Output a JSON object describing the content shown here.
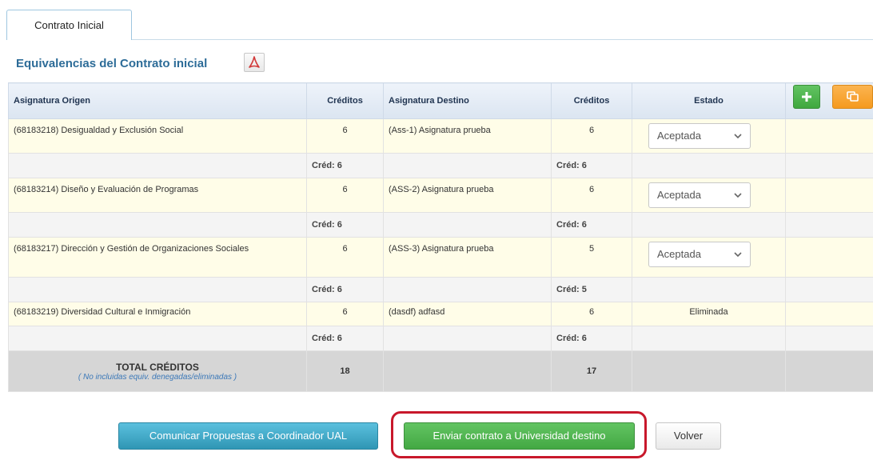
{
  "tabs": [
    {
      "label": "Contrato Inicial",
      "active": true
    }
  ],
  "section": {
    "title": "Equivalencias del Contrato inicial",
    "pdf_icon": "pdf-icon"
  },
  "table": {
    "headers": {
      "origin": "Asignatura Origen",
      "credits_origin": "Créditos",
      "destination": "Asignatura Destino",
      "credits_destination": "Créditos",
      "state": "Estado"
    },
    "rows": [
      {
        "origin": "(68183218) Desigualdad y Exclusión Social",
        "credits_origin": "6",
        "destination": "(Ass-1) Asignatura prueba",
        "credits_destination": "6",
        "state": "Aceptada",
        "state_editable": true,
        "sub_origin": "Créd: 6",
        "sub_destination": "Créd: 6"
      },
      {
        "origin": "(68183214) Diseño y Evaluación de Programas",
        "credits_origin": "6",
        "destination": "(ASS-2) Asignatura prueba",
        "credits_destination": "6",
        "state": "Aceptada",
        "state_editable": true,
        "sub_origin": "Créd: 6",
        "sub_destination": "Créd: 6"
      },
      {
        "origin": "(68183217) Dirección y Gestión de Organizaciones Sociales",
        "credits_origin": "6",
        "destination": "(ASS-3) Asignatura prueba",
        "credits_destination": "5",
        "state": "Aceptada",
        "state_editable": true,
        "sub_origin": "Créd: 6",
        "sub_destination": "Créd: 5"
      },
      {
        "origin": "(68183219) Diversidad Cultural e Inmigración",
        "credits_origin": "6",
        "destination": "(dasdf) adfasd",
        "credits_destination": "6",
        "state": "Eliminada",
        "state_editable": false,
        "sub_origin": "Créd: 6",
        "sub_destination": "Créd: 6"
      }
    ],
    "total": {
      "label": "TOTAL CRÉDITOS",
      "note": "( No incluidas equiv. denegadas/eliminadas )",
      "credits_origin": "18",
      "credits_destination": "17"
    },
    "tools": {
      "add_icon": "plus-icon",
      "copy_icon": "copy-icon"
    }
  },
  "buttons": {
    "notify": "Comunicar Propuestas a Coordinador UAL",
    "send": "Enviar contrato a Universidad destino",
    "back": "Volver"
  },
  "colors": {
    "accent_blue": "#2d6c98",
    "highlight_red": "#c8182b",
    "row_yellow": "#fffde8"
  }
}
